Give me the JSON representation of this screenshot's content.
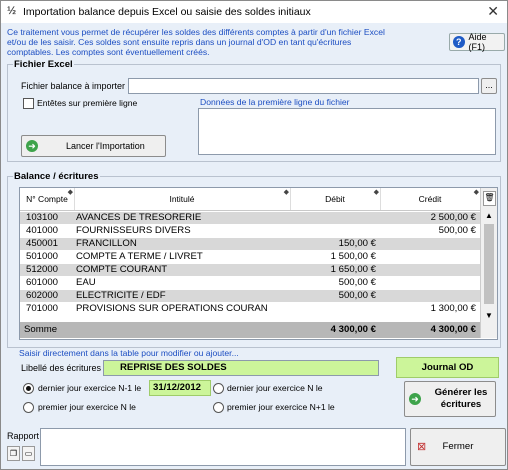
{
  "window": {
    "title": "Importation balance depuis Excel ou saisie des soldes initiaux",
    "app_icon": "½",
    "close_glyph": "✕"
  },
  "intro": {
    "line1": "Ce traitement vous permet de récupérer les soldes des différents comptes à partir d'un fichier Excel",
    "line2": "et/ou de les saisir. Ces soldes sont ensuite repris dans un journal d'OD en tant qu'écritures",
    "line3": "comptables. Les comptes sont éventuellement créés."
  },
  "help_button": {
    "label": "Aide (F1)",
    "icon_glyph": "?"
  },
  "fichier": {
    "title": "Fichier Excel",
    "file_label": "Fichier balance à importer :",
    "file_value": "",
    "browse_label": "...",
    "header_checkbox_label": "Entêtes sur première ligne",
    "header_checked": false,
    "first_line_label": "Données de la première ligne du fichier",
    "import_button": "Lancer l'Importation"
  },
  "balance": {
    "title": "Balance / écritures",
    "columns": [
      "N° Compte",
      "Intitulé",
      "Débit",
      "Crédit"
    ],
    "rows": [
      {
        "compte": "103100",
        "intitule": "AVANCES DE TRESORERIE",
        "debit": "",
        "credit": "2 500,00 €"
      },
      {
        "compte": "401000",
        "intitule": "FOURNISSEURS DIVERS",
        "debit": "",
        "credit": "500,00 €"
      },
      {
        "compte": "450001",
        "intitule": "FRANCILLON",
        "debit": "150,00 €",
        "credit": ""
      },
      {
        "compte": "501000",
        "intitule": "COMPTE A TERME / LIVRET",
        "debit": "1 500,00 €",
        "credit": ""
      },
      {
        "compte": "512000",
        "intitule": "COMPTE COURANT",
        "debit": "1 650,00 €",
        "credit": ""
      },
      {
        "compte": "601000",
        "intitule": "EAU",
        "debit": "500,00 €",
        "credit": ""
      },
      {
        "compte": "602000",
        "intitule": "ELECTRICITE / EDF",
        "debit": "500,00 €",
        "credit": ""
      },
      {
        "compte": "701000",
        "intitule": "PROVISIONS SUR OPERATIONS COURAN",
        "debit": "",
        "credit": "1 300,00 €"
      }
    ],
    "sum_label": "Somme",
    "sum_debit": "4 300,00 €",
    "sum_credit": "4 300,00 €"
  },
  "saisie_hint": "Saisir directement dans la table pour modifier ou ajouter...",
  "libelle": {
    "label": "Libellé des écritures",
    "value": "REPRISE DES SOLDES"
  },
  "journal_label": "Journal OD",
  "date_options": {
    "opt1": "dernier jour exercice N-1 le",
    "opt1_date": "31/12/2012",
    "opt2": "dernier jour exercice N le",
    "opt3": "premier jour exercice N le",
    "opt4": "premier jour exercice N+1 le",
    "selected": "opt1"
  },
  "generate_button": {
    "line1": "Générer les",
    "line2": "écritures"
  },
  "rapport": {
    "label": "Rapport",
    "value": ""
  },
  "close_button": "Fermer",
  "colors": {
    "link_blue": "#1c4ec2",
    "highlight_green": "#ccf59a",
    "row_alt": "#d8d8d8"
  }
}
